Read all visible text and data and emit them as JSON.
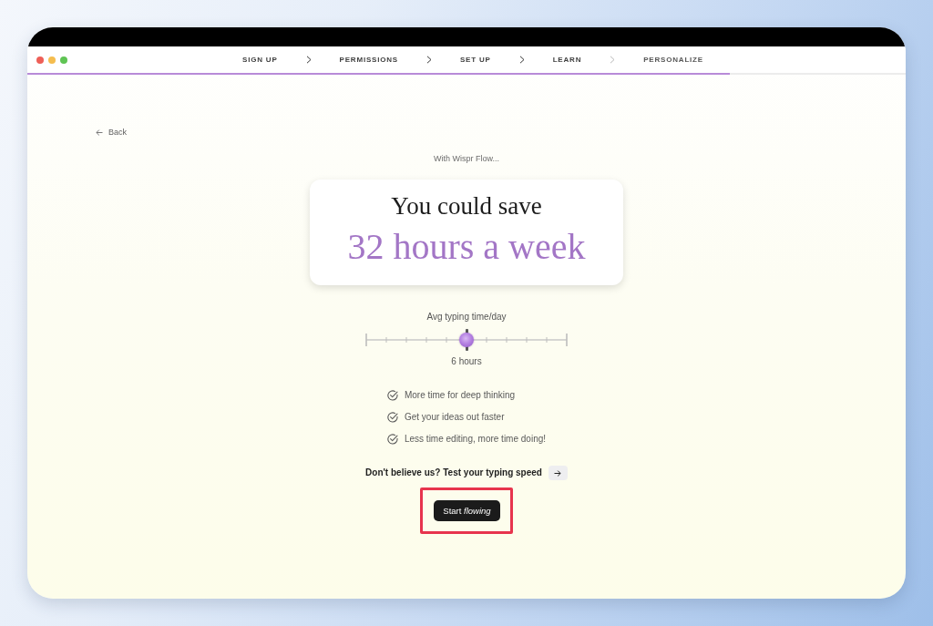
{
  "window": {
    "controls": [
      {
        "color": "#ee5f57"
      },
      {
        "color": "#f5bd4f"
      },
      {
        "color": "#5fc454"
      }
    ]
  },
  "steps": [
    {
      "label": "SIGN UP",
      "completed": true
    },
    {
      "label": "PERMISSIONS",
      "completed": true
    },
    {
      "label": "SET UP",
      "completed": true
    },
    {
      "label": "LEARN",
      "completed": true
    },
    {
      "label": "PERSONALIZE",
      "completed": false
    }
  ],
  "progress": {
    "level": 0.8
  },
  "back_link": {
    "label": "Back"
  },
  "intro": "With Wispr Flow...",
  "savings_card": {
    "headline": "You could save",
    "amount": "32 hours a week"
  },
  "slider": {
    "label": "Avg typing time/day",
    "level": 0.5,
    "reading": "6 hours"
  },
  "benefits": [
    "More time for deep thinking",
    "Get your ideas out faster",
    "Less time editing, more time doing!"
  ],
  "typing_test": {
    "prompt": "Don't believe us? Test your typing speed"
  },
  "start_button": {
    "label": "Start *flowing*",
    "highlighted": true
  }
}
